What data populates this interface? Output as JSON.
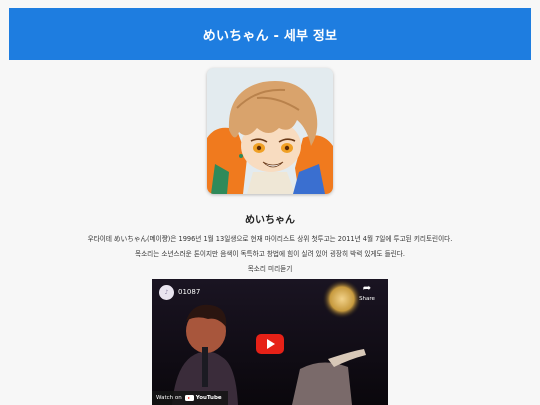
{
  "header": {
    "title": "めいちゃん - 세부 정보"
  },
  "profile": {
    "name": "めいちゃん",
    "description_1": "우타이테 めいちゃん(메이쨩)은 1996년 1월 13일생으로 현재 마이리스트 상위 첫투고는 2011년 4월 7일에 투고된 키리토린이다.",
    "description_2": "목소리는 소년스러운 톤이지만 음색이 독특하고 창법에 힘이 실려 있어 굉장히 박력 있게도 들린다.",
    "preview_label": "목소리 미리듣기"
  },
  "video": {
    "title": "01087",
    "share_label": "Share",
    "share_icon": "share-arrow-icon",
    "play_icon": "play-icon",
    "watch_on_label": "Watch on",
    "youtube_label": "YouTube",
    "colors": {
      "play_button": "#e62117",
      "background": "#0d0a12"
    }
  },
  "colors": {
    "header_bg": "#1e7de0",
    "page_bg": "#f7f7f7"
  }
}
